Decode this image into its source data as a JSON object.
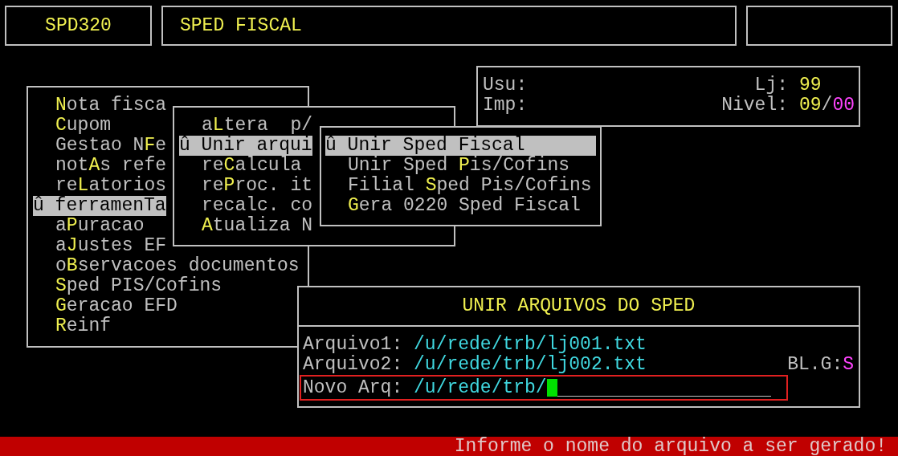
{
  "header": {
    "program_code": "SPD320",
    "title": "SPED FISCAL"
  },
  "info": {
    "user_label": "Usu:",
    "printer_label": "Imp:",
    "store_label": "Lj:",
    "store_value": "99",
    "level_label": "Nivel:",
    "level_value": "09",
    "level_separator": "/",
    "level_sublevel": "00"
  },
  "main_menu": [
    {
      "label": "**N**ota fisca",
      "selected": false
    },
    {
      "label": "**C**upom",
      "selected": false
    },
    {
      "label": "Gestao N**F**e",
      "selected": false
    },
    {
      "label": "not**A**s refe",
      "selected": false
    },
    {
      "label": "re**L**atorios",
      "selected": false
    },
    {
      "label": "û ferramenTa",
      "selected": true
    },
    {
      "label": "a**P**uracao",
      "selected": false
    },
    {
      "label": "a**J**ustes EF",
      "selected": false
    },
    {
      "label": "o**B**servacoes documentos",
      "selected": false
    },
    {
      "label": "**S**ped PIS/Cofins",
      "selected": false
    },
    {
      "label": "**G**eracao EFD",
      "selected": false
    },
    {
      "label": "**R**einf",
      "selected": false
    }
  ],
  "submenu": [
    {
      "label": "a**L**tera  p/",
      "selected": false
    },
    {
      "label": "û Unir arqui",
      "selected": true
    },
    {
      "label": "re**C**alcula",
      "selected": false
    },
    {
      "label": "re**P**roc. it",
      "selected": false
    },
    {
      "label": "recalc. co",
      "selected": false
    },
    {
      "label": "**A**tualiza N",
      "selected": false
    }
  ],
  "submenu_2": [
    {
      "label": "û Unir Sped Fiscal",
      "selected": true
    },
    {
      "label": "Unir Sped **P**is/Cofins",
      "selected": false
    },
    {
      "label": "Filial **S**ped Pis/Cofins",
      "selected": false
    },
    {
      "label": "**G**era 0220 Sped Fiscal",
      "selected": false
    }
  ],
  "dialog": {
    "title": "UNIR ARQUIVOS DO SPED",
    "files": [
      {
        "label": "Arquivo1:",
        "value": "/u/rede/trb/lj001.txt"
      },
      {
        "label": "Arquivo2:",
        "value": "/u/rede/trb/lj002.txt"
      }
    ],
    "option_label": "BL.G:",
    "option_value": "S",
    "new_file": {
      "label": "Novo Arq:",
      "value": "/u/rede/trb/",
      "focused": true
    }
  },
  "status_bar": {
    "message": "Informe o nome do arquivo a ser gerado!"
  }
}
